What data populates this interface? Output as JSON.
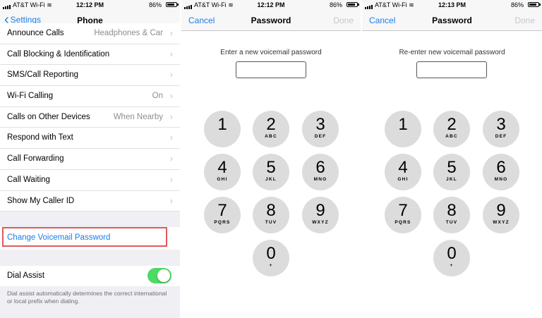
{
  "status_bar": {
    "carrier": "AT&T Wi-Fi",
    "screens": [
      {
        "time": "12:12 PM",
        "battery": "86%"
      },
      {
        "time": "12:12 PM",
        "battery": "86%"
      },
      {
        "time": "12:13 PM",
        "battery": "86%"
      }
    ],
    "battery_level": 0.86
  },
  "settings": {
    "back_label": "Settings",
    "title": "Phone",
    "rows": [
      {
        "label": "Announce Calls",
        "value": "Headphones & Car"
      },
      {
        "label": "Call Blocking & Identification",
        "value": ""
      },
      {
        "label": "SMS/Call Reporting",
        "value": ""
      },
      {
        "label": "Wi-Fi Calling",
        "value": "On"
      },
      {
        "label": "Calls on Other Devices",
        "value": "When Nearby"
      },
      {
        "label": "Respond with Text",
        "value": ""
      },
      {
        "label": "Call Forwarding",
        "value": ""
      },
      {
        "label": "Call Waiting",
        "value": ""
      },
      {
        "label": "Show My Caller ID",
        "value": ""
      }
    ],
    "change_voicemail": "Change Voicemail Password",
    "dial_assist_label": "Dial Assist",
    "dial_assist_on": true,
    "dial_assist_note": "Dial assist automatically determines the correct international or local prefix when dialing.",
    "chevron": "›"
  },
  "password_screens": [
    {
      "cancel": "Cancel",
      "title": "Password",
      "done": "Done",
      "prompt": "Enter a new voicemail password"
    },
    {
      "cancel": "Cancel",
      "title": "Password",
      "done": "Done",
      "prompt": "Re-enter new voicemail password"
    }
  ],
  "keypad": [
    {
      "digit": "1",
      "letters": ""
    },
    {
      "digit": "2",
      "letters": "ABC"
    },
    {
      "digit": "3",
      "letters": "DEF"
    },
    {
      "digit": "4",
      "letters": "GHI"
    },
    {
      "digit": "5",
      "letters": "JKL"
    },
    {
      "digit": "6",
      "letters": "MNO"
    },
    {
      "digit": "7",
      "letters": "PQRS"
    },
    {
      "digit": "8",
      "letters": "TUV"
    },
    {
      "digit": "9",
      "letters": "WXYZ"
    },
    {
      "digit": "0",
      "letters": "+"
    }
  ],
  "colors": {
    "accent": "#1a7ee8",
    "toggle_on": "#4cd964",
    "highlight": "#e05a5a",
    "key_bg": "#dcdcdc"
  }
}
